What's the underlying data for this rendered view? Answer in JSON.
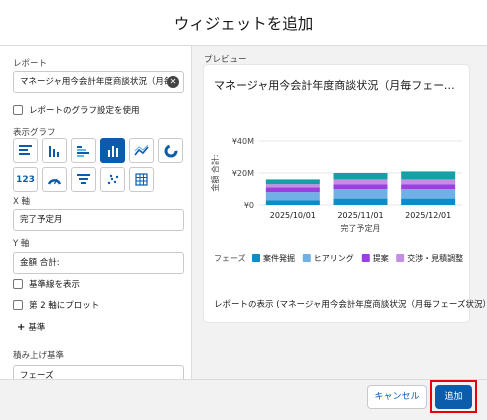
{
  "modal": {
    "title": "ウィジェットを追加"
  },
  "left": {
    "report_label": "レポート",
    "report_value": "マネージャ用今会計年度商談状況（月毎",
    "use_report_chart_label": "レポートのグラフ設定を使用",
    "display_chart_label": "表示グラフ",
    "chart_types": [
      {
        "icon": "horizontal-bar-icon",
        "selected": false
      },
      {
        "icon": "vertical-bar-icon",
        "selected": false
      },
      {
        "icon": "grouped-bar-icon",
        "selected": false
      },
      {
        "icon": "stacked-bar-icon",
        "selected": true
      },
      {
        "icon": "line-chart-icon",
        "selected": false
      },
      {
        "icon": "donut-icon",
        "selected": false
      },
      {
        "icon": "metric-icon",
        "text": "123",
        "selected": false
      },
      {
        "icon": "gauge-icon",
        "selected": false
      },
      {
        "icon": "funnel-icon",
        "selected": false
      },
      {
        "icon": "scatter-icon",
        "selected": false
      },
      {
        "icon": "table-icon",
        "selected": false
      }
    ],
    "x_axis_label": "X 軸",
    "x_axis_value": "完了予定月",
    "y_axis_label": "Y 軸",
    "y_axis_value": "金額 合計:",
    "show_reference_line_label": "基準線を表示",
    "plot_second_axis_label": "第 2 軸にプロット",
    "add_reference_label": "基準",
    "stack_by_label": "積み上げ基準",
    "stack_by_value": "フェーズ"
  },
  "preview": {
    "label": "プレビュー",
    "card_title": "マネージャ用今会計年度商談状況（月毎フェーズ…",
    "legend_title": "フェーズ",
    "footer_text": "レポートの表示 (マネージャ用今会計年度商談状況（月毎フェーズ状況）)"
  },
  "chart_data": {
    "type": "bar",
    "stacked": true,
    "orientation": "vertical",
    "categories": [
      "2025/10/01",
      "2025/11/01",
      "2025/12/01"
    ],
    "series": [
      {
        "name": "案件発掘",
        "color": "#0b8dc7",
        "values": [
          3,
          4,
          4
        ]
      },
      {
        "name": "ヒアリング",
        "color": "#6fb1e6",
        "values": [
          5,
          6,
          6
        ]
      },
      {
        "name": "提案",
        "color": "#9b3fdf",
        "values": [
          3,
          3,
          3
        ]
      },
      {
        "name": "交渉・見積調整",
        "color": "#c58ee6",
        "values": [
          2,
          3,
          3
        ]
      },
      {
        "name": "",
        "color": "#14a1a6",
        "values": [
          3,
          4,
          5
        ]
      }
    ],
    "ylabel": "金額 合計:",
    "xlabel": "完了予定月",
    "y_ticks": [
      "¥0",
      "¥20M",
      "¥40M"
    ],
    "ylim": [
      0,
      40
    ],
    "grid": true,
    "legend_position": "bottom"
  },
  "footer": {
    "cancel_label": "キャンセル",
    "add_label": "追加"
  },
  "colors": {
    "accent": "#0b5cab",
    "highlight": "#e8000b"
  }
}
